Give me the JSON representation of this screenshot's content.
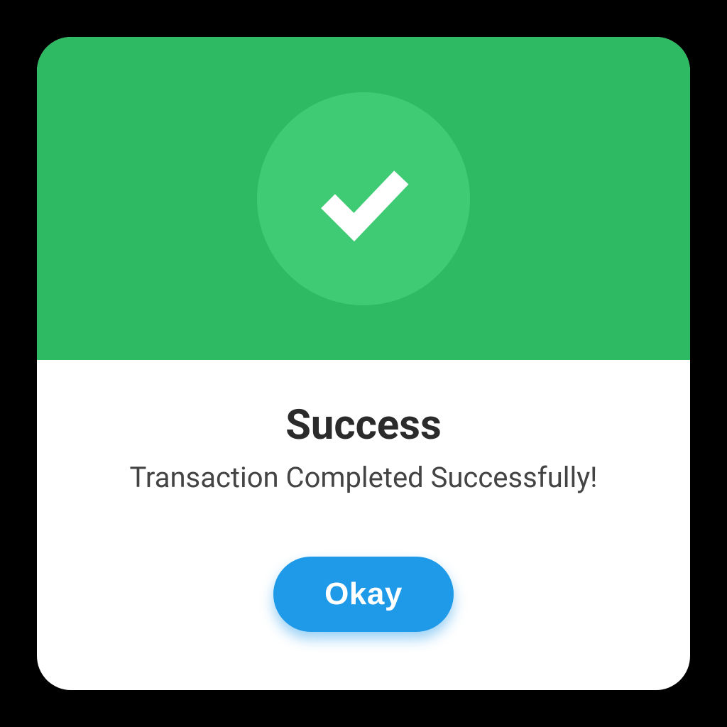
{
  "dialog": {
    "icon": "check-icon",
    "title": "Success",
    "message": "Transaction Completed Successfully!",
    "button_label": "Okay"
  },
  "colors": {
    "header_bg": "#2dba63",
    "check_circle_bg": "#3fcb74",
    "button_bg": "#1e9ae8"
  }
}
